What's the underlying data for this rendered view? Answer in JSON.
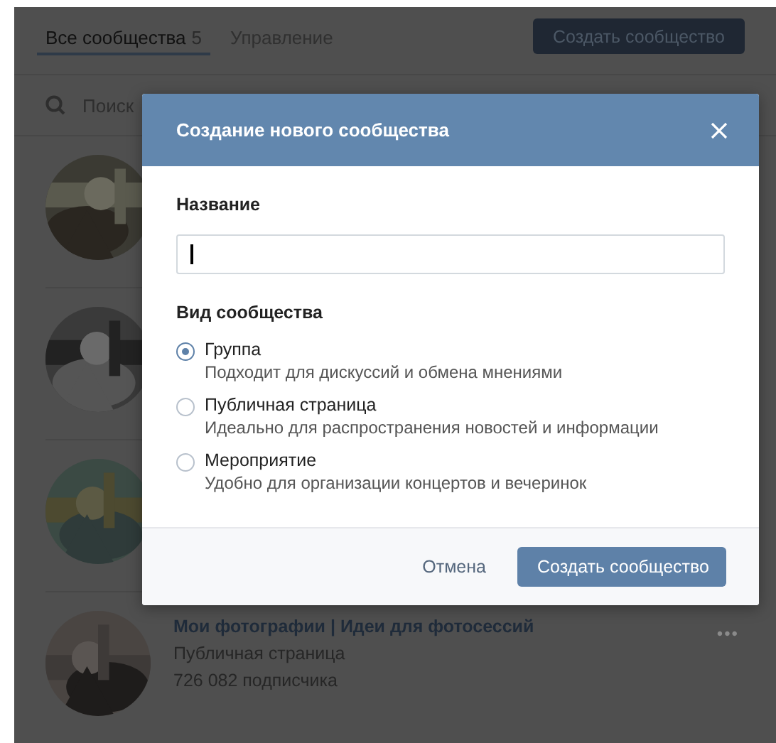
{
  "page": {
    "tabs": [
      {
        "label": "Все сообщества",
        "count": "5",
        "selected": true
      },
      {
        "label": "Управление",
        "selected": false
      }
    ],
    "create_button": "Создать сообщество",
    "search": {
      "placeholder": "Поиск"
    },
    "communities": [
      {
        "avatar": {
          "kind": "picture"
        }
      },
      {
        "avatar": {
          "kind": "picture"
        }
      },
      {
        "avatar": {
          "kind": "picture"
        }
      },
      {
        "avatar": {
          "kind": "picture"
        },
        "title": "Мои фотографии | Идеи для фотосессий",
        "type": "Публичная страница",
        "subscribers": "726 082 подписчика",
        "menu": "•••"
      }
    ]
  },
  "dialog": {
    "title": "Создание нового сообщества",
    "name_label": "Название",
    "name_field": {
      "focused": true
    },
    "type_label": "Вид сообщества",
    "options": [
      {
        "label": "Группа",
        "description": "Подходит для дискуссий и обмена мнениями",
        "selected": true
      },
      {
        "label": "Публичная страница",
        "description": "Идеально для распространения новостей и информации",
        "selected": false
      },
      {
        "label": "Мероприятие",
        "description": "Удобно для организации концертов и вечеринок",
        "selected": false
      }
    ],
    "cancel_button": "Отмена",
    "submit_button": "Создать сообщество"
  }
}
